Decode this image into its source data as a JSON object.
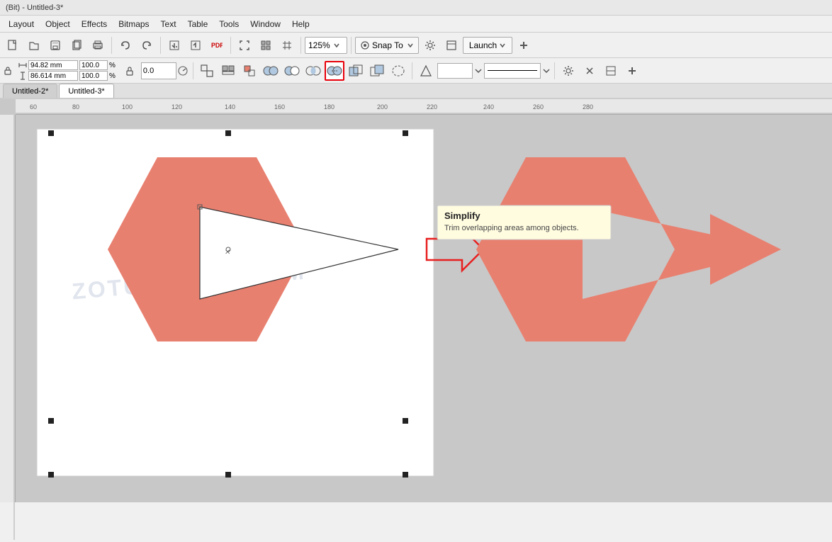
{
  "titleBar": {
    "text": "(Bit) - Untitled-3*"
  },
  "menuBar": {
    "items": [
      "Layout",
      "Object",
      "Effects",
      "Bitmaps",
      "Text",
      "Table",
      "Tools",
      "Window",
      "Help"
    ]
  },
  "toolbar1": {
    "zoom": "125%",
    "snapTo": "Snap To",
    "launch": "Launch",
    "buttons": [
      {
        "name": "new",
        "icon": "🗋"
      },
      {
        "name": "open",
        "icon": "📂"
      },
      {
        "name": "save-small",
        "icon": "💾"
      },
      {
        "name": "save-copy",
        "icon": "📋"
      },
      {
        "name": "print",
        "icon": "🖨"
      },
      {
        "name": "undo",
        "icon": "↩"
      },
      {
        "name": "redo",
        "icon": "↪"
      },
      {
        "name": "import",
        "icon": "📥"
      },
      {
        "name": "export",
        "icon": "📤"
      },
      {
        "name": "export-pdf",
        "icon": "📄"
      },
      {
        "name": "full-screen",
        "icon": "⛶"
      },
      {
        "name": "view-mode",
        "icon": "▦"
      },
      {
        "name": "grid",
        "icon": "⊞"
      },
      {
        "name": "snap-icon",
        "icon": "⊕"
      },
      {
        "name": "touch",
        "icon": "⚙"
      }
    ]
  },
  "toolbar2": {
    "width": "94.82 mm",
    "height": "86.614 mm",
    "widthPct": "100.0",
    "heightPct": "100.0",
    "angle": "0.0",
    "buttons": [
      "transform-position",
      "transform-scale",
      "transform-rotate",
      "simplify",
      "trim",
      "intersect",
      "front-back",
      "weld",
      "active-btn",
      "boundary",
      "simplify-trim",
      "attach",
      "pen",
      "plus"
    ]
  },
  "tabs": [
    {
      "label": "Untitled-2*",
      "active": false
    },
    {
      "label": "Untitled-3*",
      "active": true
    }
  ],
  "tooltip": {
    "title": "Simplify",
    "description": "Trim overlapping areas among objects."
  },
  "ruler": {
    "marks": [
      "60",
      "80",
      "100",
      "120",
      "140",
      "160",
      "180",
      "200",
      "220",
      "240",
      "260",
      "280"
    ]
  },
  "colors": {
    "hexagonFill": "#e88070",
    "arrowFill": "#e82020",
    "canvasBg": "#c8c8c8",
    "whiteBg": "#ffffff",
    "accent": "#e8000a"
  },
  "watermark": "ZOTUTORIAL.COM"
}
